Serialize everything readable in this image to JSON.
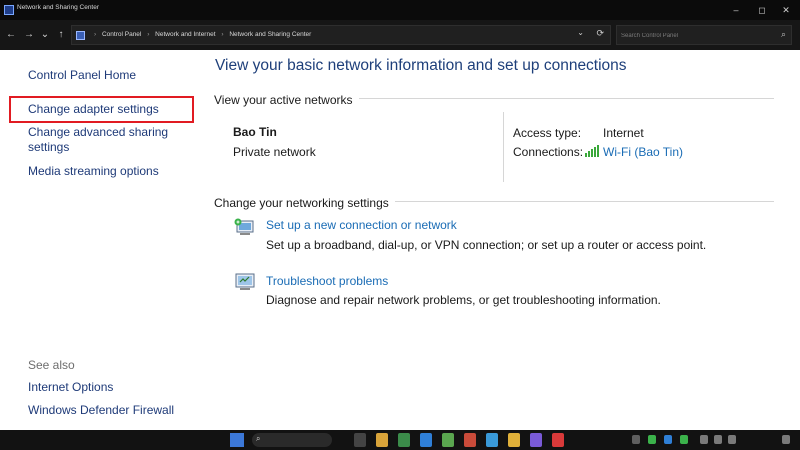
{
  "window": {
    "title": "Network and Sharing Center",
    "minimize": "–",
    "maximize": "◻",
    "close": "✕"
  },
  "nav": {
    "back": "←",
    "forward": "→",
    "recent": "⌄",
    "up": "↑"
  },
  "address": {
    "crumbs": [
      "Control Panel",
      "Network and Internet",
      "Network and Sharing Center"
    ],
    "dropdown": "⌄",
    "refresh": "⟳"
  },
  "search": {
    "placeholder": "Search Control Panel"
  },
  "sidebar": {
    "home": "Control Panel Home",
    "items": [
      {
        "label": "Change adapter settings"
      },
      {
        "label": "Change advanced sharing\nsettings"
      },
      {
        "label": "Media streaming options"
      }
    ],
    "see_also_heading": "See also",
    "see_also": [
      {
        "label": "Internet Options"
      },
      {
        "label": "Windows Defender Firewall"
      }
    ]
  },
  "main": {
    "title": "View your basic network information and set up connections",
    "active_networks_heading": "View your active networks",
    "network": {
      "name": "Bao Tin",
      "category": "Private network",
      "access_type_label": "Access type:",
      "access_type_value": "Internet",
      "connections_label": "Connections:",
      "connection_value": "Wi-Fi (Bao Tin)"
    },
    "change_settings_heading": "Change your networking settings",
    "tasks": [
      {
        "link": "Set up a new connection or network",
        "description": "Set up a broadband, dial-up, or VPN connection; or set up a router or access point."
      },
      {
        "link": "Troubleshoot problems",
        "description": "Diagnose and repair network problems, or get troubleshooting information."
      }
    ]
  },
  "colors": {
    "highlight": "#e11b22",
    "link": "#1a6cb5",
    "title": "#1e3f7a"
  }
}
